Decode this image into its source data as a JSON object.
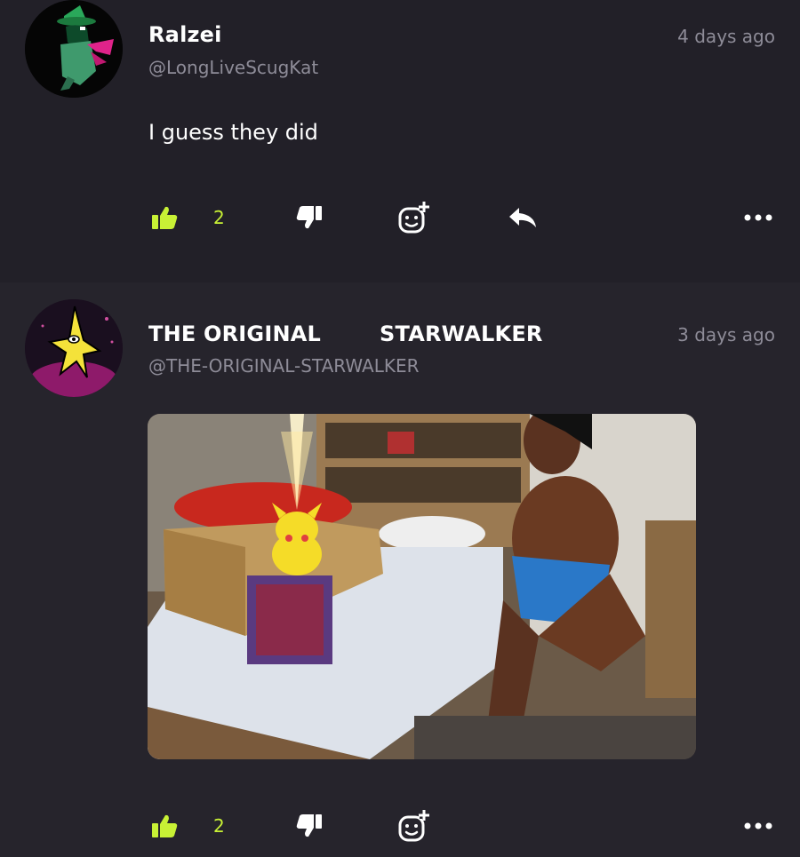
{
  "colors": {
    "accent": "#c8f135",
    "muted": "#8e8c98",
    "background": "#222028"
  },
  "comments": [
    {
      "author": "Ralzei",
      "handle": "@LongLiveScugKat",
      "time": "4 days ago",
      "text": "I guess they did",
      "likes": "2",
      "icons": [
        "thumbs-up-icon",
        "thumbs-down-icon",
        "add-reaction-icon",
        "reply-icon",
        "more-icon"
      ]
    },
    {
      "author_first": "THE ORIGINAL",
      "author_second": "STARWALKER",
      "handle": "@THE-ORIGINAL-STARWALKER",
      "time": "3 days ago",
      "likes": "2",
      "icons": [
        "thumbs-up-icon",
        "thumbs-down-icon",
        "add-reaction-icon",
        "more-icon"
      ]
    }
  ]
}
